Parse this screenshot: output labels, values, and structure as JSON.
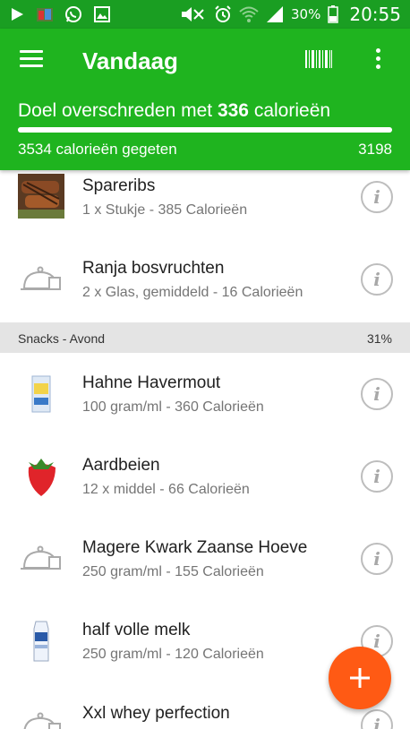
{
  "status_bar": {
    "time": "20:55",
    "battery": "30%",
    "icons_left": [
      "play-icon",
      "photo-icon",
      "whatsapp-icon",
      "gallery-icon"
    ],
    "icons_right": [
      "mute-icon",
      "alarm-icon",
      "wifi-icon",
      "signal-icon",
      "battery-icon"
    ]
  },
  "header": {
    "title": "Vandaag",
    "goal_prefix": "Doel overschreden met ",
    "goal_amount": "336",
    "goal_suffix": " calorieën",
    "eaten": "3534 calorieën gegeten",
    "target": "3198",
    "progress": 1.0
  },
  "items_top": [
    {
      "name": "Spareribs",
      "detail": "1 x Stukje - 385 Calorieën",
      "thumb": "spareribs-photo"
    },
    {
      "name": "Ranja bosvruchten",
      "detail": "2 x Glas, gemiddeld - 16 Calorieën",
      "thumb": "dish-icon"
    }
  ],
  "section": {
    "title": "Snacks - Avond",
    "percent": "31%"
  },
  "items_snacks": [
    {
      "name": "Hahne Havermout",
      "detail": "100 gram/ml - 360 Calorieën",
      "thumb": "oat-package-photo"
    },
    {
      "name": "Aardbeien",
      "detail": "12 x middel - 66 Calorieën",
      "thumb": "strawberry-photo"
    },
    {
      "name": "Magere Kwark Zaanse Hoeve",
      "detail": "250 gram/ml - 155 Calorieën",
      "thumb": "dish-icon"
    },
    {
      "name": "half volle melk",
      "detail": "250 gram/ml - 120 Calorieën",
      "thumb": "milk-carton-photo"
    },
    {
      "name": "Xxl whey perfection",
      "detail": "",
      "thumb": "dish-icon"
    }
  ],
  "info_label": "i",
  "fab_label": "+",
  "colors": {
    "status_bar": "#1a9e22",
    "header": "#1fb41f",
    "fab": "#ff5a14",
    "section_bg": "#e4e4e4"
  }
}
